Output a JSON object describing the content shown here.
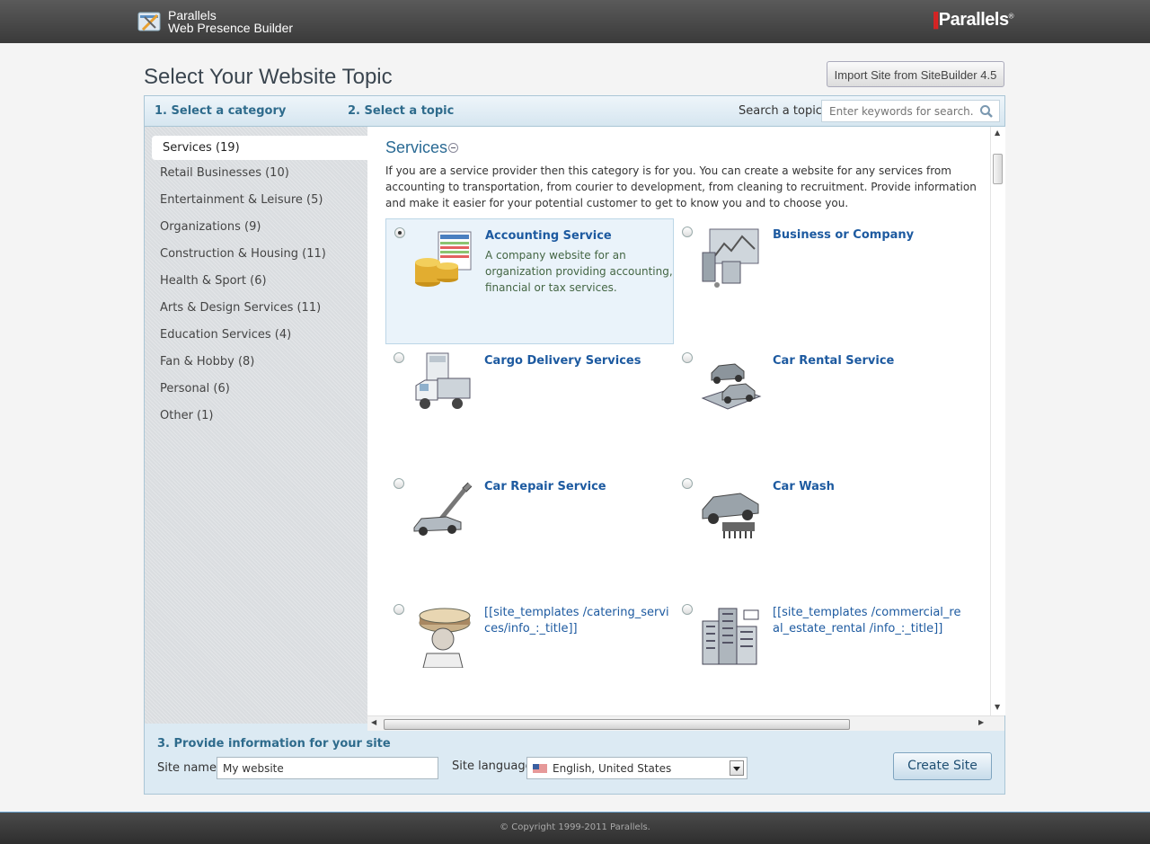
{
  "header": {
    "app_name_line1": "Parallels",
    "app_name_line2": "Web Presence Builder",
    "vendor_logo": "Parallels",
    "vendor_logo_mark": "||",
    "vendor_logo_reg": "®"
  },
  "page": {
    "title": "Select Your Website Topic",
    "import_button": "Import Site from SiteBuilder 4.5"
  },
  "steps": {
    "step1": "1. Select a category",
    "step2": "2. Select a topic",
    "step3": "3. Provide information for your site"
  },
  "search": {
    "label": "Search a topic",
    "placeholder": "Enter keywords for search."
  },
  "categories": [
    {
      "label": "Services (19)",
      "active": true
    },
    {
      "label": "Retail Businesses (10)"
    },
    {
      "label": "Entertainment & Leisure (5)"
    },
    {
      "label": "Organizations (9)"
    },
    {
      "label": "Construction & Housing (11)"
    },
    {
      "label": "Health & Sport (6)"
    },
    {
      "label": "Arts & Design Services (11)"
    },
    {
      "label": "Education Services (4)"
    },
    {
      "label": "Fan & Hobby (8)"
    },
    {
      "label": "Personal (6)"
    },
    {
      "label": "Other (1)"
    }
  ],
  "section": {
    "title": "Services",
    "description": "If you are a service provider then this category is for you. You can create a website for any services from accounting to transportation, from courier to development, from cleaning to recruitment. Provide information and make it easier for your potential customer to get to know you and to choose you."
  },
  "topics": [
    {
      "title": "Accounting Service",
      "description": "A company website for an organization providing accounting, financial or tax services.",
      "selected": true,
      "icon": "coins-ledger-icon"
    },
    {
      "title": "Business or Company",
      "description": "",
      "selected": false,
      "icon": "office-icon"
    },
    {
      "title": "Cargo Delivery Services",
      "description": "",
      "selected": false,
      "icon": "truck-icon"
    },
    {
      "title": "Car Rental Service",
      "description": "",
      "selected": false,
      "icon": "cars-icon"
    },
    {
      "title": "Car Repair Service",
      "description": "",
      "selected": false,
      "icon": "car-lift-icon"
    },
    {
      "title": "Car Wash",
      "description": "",
      "selected": false,
      "icon": "car-wash-icon"
    },
    {
      "title": "[[site_templates /catering_services/info_:_title]]",
      "description": "",
      "selected": false,
      "icon": "chef-cake-icon"
    },
    {
      "title": "[[site_templates /commercial_real_estate_rental /info_:_title]]",
      "description": "",
      "selected": false,
      "icon": "buildings-icon"
    }
  ],
  "site_info": {
    "site_name_label": "Site name",
    "site_name_value": "My website",
    "site_language_label": "Site language",
    "site_language_value": "English, United States",
    "create_button": "Create Site"
  },
  "footer": {
    "copyright": "© Copyright 1999-2011 Parallels."
  },
  "colors": {
    "accent": "#2e6b8c",
    "link": "#1d5aa0",
    "logo_red": "#dd2222"
  }
}
